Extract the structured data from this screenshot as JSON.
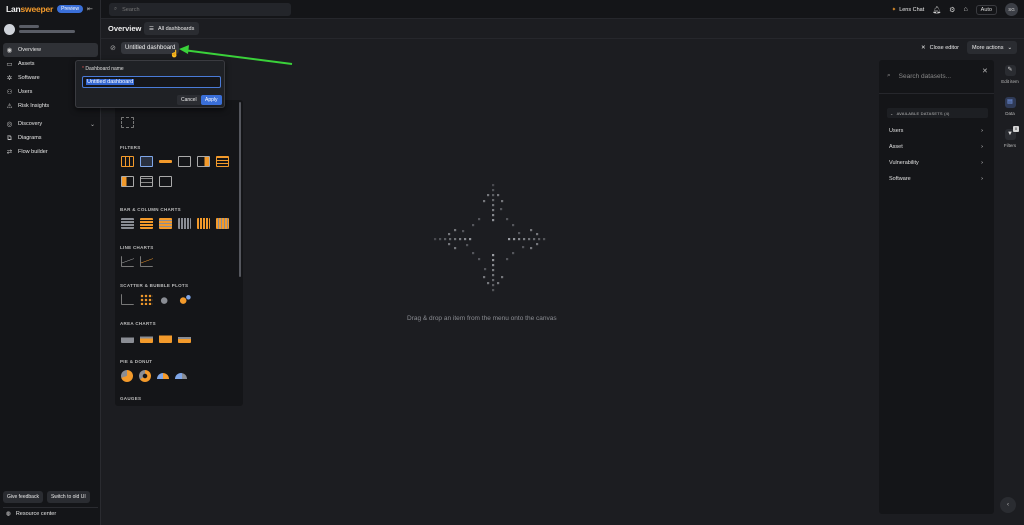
{
  "brand": {
    "name_prefix": "Lan",
    "name_suffix": "sweeper",
    "badge": "Preview"
  },
  "sidebar": {
    "items": [
      {
        "label": "Overview",
        "icon": "overview-icon"
      },
      {
        "label": "Assets",
        "icon": "assets-icon"
      },
      {
        "label": "Software",
        "icon": "software-icon"
      },
      {
        "label": "Users",
        "icon": "users-icon"
      },
      {
        "label": "Risk Insights",
        "icon": "risk-icon"
      },
      {
        "label": "Discovery",
        "icon": "discovery-icon"
      },
      {
        "label": "Diagrams",
        "icon": "diagrams-icon"
      },
      {
        "label": "Flow builder",
        "icon": "flow-icon"
      }
    ],
    "give_feedback": "Give feedback",
    "switch_old": "Switch to old UI",
    "resource_center": "Resource center"
  },
  "topbar": {
    "search_placeholder": "Search",
    "lens_chat": "Lens Chat",
    "theme": "Auto",
    "avatar_initials": "SG"
  },
  "header": {
    "title": "Overview",
    "all_dashboards": "All dashboards"
  },
  "editor": {
    "dashboard_name": "Untitled dashboard",
    "close_editor": "Close editor",
    "more_actions": "More actions"
  },
  "popup": {
    "label": "Dashboard name",
    "value": "Untitled dashboard",
    "cancel": "Cancel",
    "apply": "Apply"
  },
  "palette": {
    "sections": [
      "FILTERS",
      "BAR & COLUMN CHARTS",
      "LINE CHARTS",
      "SCATTER & BUBBLE PLOTS",
      "AREA CHARTS",
      "PIE & DONUT",
      "GAUGES"
    ]
  },
  "canvas": {
    "hint": "Drag & drop an item from the menu onto the canvas"
  },
  "datasets": {
    "search_placeholder": "Search datasets...",
    "section": "AVAILABLE DATASETS (4)",
    "items": [
      "Users",
      "Asset",
      "Vulnerability",
      "Software"
    ]
  },
  "rail": {
    "edit_item": "Edit item",
    "data": "Data",
    "filters": "Filters",
    "filter_count": "0"
  },
  "colors": {
    "accent": "#f39a2b",
    "primary": "#3a6fd8",
    "arrow": "#3ad13a"
  }
}
